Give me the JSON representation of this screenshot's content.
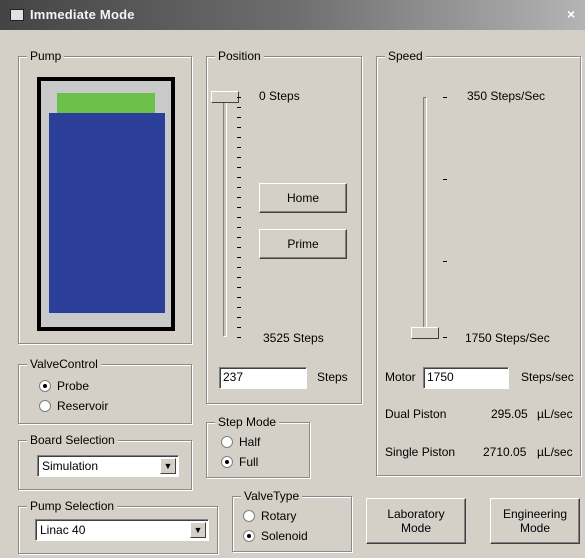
{
  "window": {
    "title": "Immediate Mode",
    "close_glyph": "×"
  },
  "pump": {
    "legend": "Pump",
    "fill_fraction": 1.0,
    "top_color": "#6cc04a",
    "body_color": "#2b3f98"
  },
  "position": {
    "legend": "Position",
    "top_label": "0 Steps",
    "bottom_label": "3525 Steps",
    "slider_fraction": 0.0,
    "home_label": "Home",
    "prime_label": "Prime",
    "steps_value": "237",
    "steps_unit": "Steps"
  },
  "speed": {
    "legend": "Speed",
    "top_label": "350 Steps/Sec",
    "bottom_label": "1750 Steps/Sec",
    "slider_fraction": 1.0,
    "motor_label": "Motor",
    "motor_value": "1750",
    "motor_unit": "Steps/sec",
    "dual_label": "Dual Piston",
    "dual_value": "295.05",
    "dual_unit": "µL/sec",
    "single_label": "Single Piston",
    "single_value": "2710.05",
    "single_unit": "µL/sec"
  },
  "valve_control": {
    "legend": "ValveControl",
    "options": [
      "Probe",
      "Reservoir"
    ],
    "selected": "Probe"
  },
  "board_selection": {
    "legend": "Board Selection",
    "value": "Simulation"
  },
  "step_mode": {
    "legend": "Step Mode",
    "options": [
      "Half",
      "Full"
    ],
    "selected": "Full"
  },
  "pump_selection": {
    "legend": "Pump Selection",
    "value": "Linac 40"
  },
  "valve_type": {
    "legend": "ValveType",
    "options": [
      "Rotary",
      "Solenoid"
    ],
    "selected": "Solenoid"
  },
  "buttons": {
    "laboratory_line1": "Laboratory",
    "laboratory_line2": "Mode",
    "engineering_line1": "Engineering",
    "engineering_line2": "Mode"
  },
  "icons": {
    "dropdown": "▼"
  }
}
